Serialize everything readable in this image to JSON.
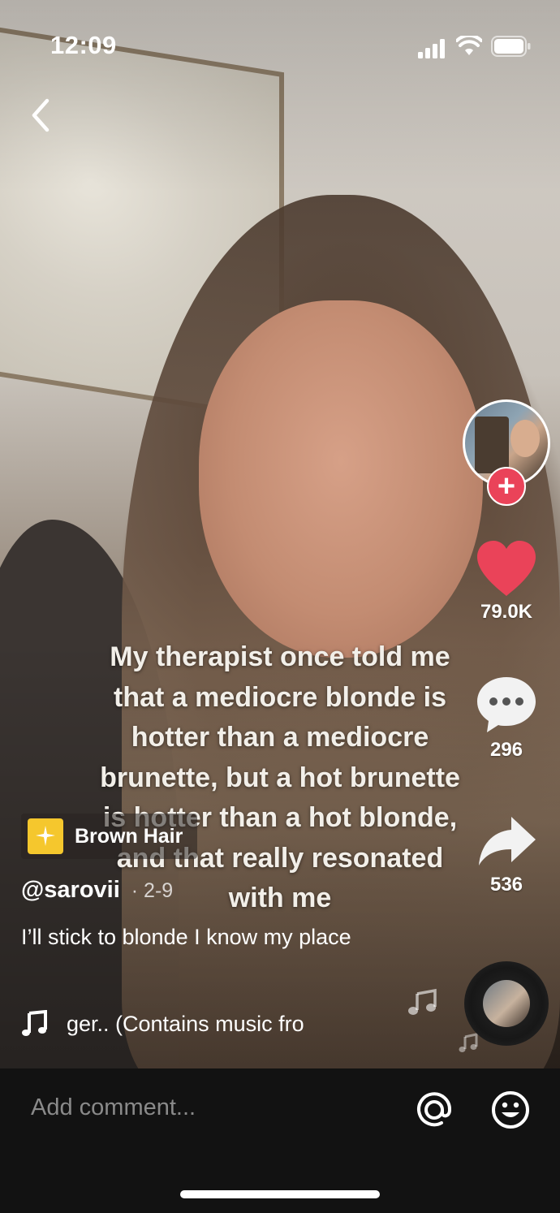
{
  "status_bar": {
    "time": "12:09"
  },
  "video": {
    "overlay_text": "My therapist once told me\nthat a mediocre blonde is\nhotter than a mediocre\nbrunette, but a hot brunette\nis hotter than a hot blonde,\nand that really resonated\nwith me"
  },
  "actions": {
    "likes": "79.0K",
    "comments": "296",
    "shares": "536",
    "like_color": "#ea4359"
  },
  "effect_tag": {
    "label": "Brown Hair"
  },
  "post": {
    "username": "@sarovii",
    "date": "· 2-9",
    "description": "I’ll stick to blonde I know my place",
    "music": "ger.. (Contains music fro"
  },
  "comment_bar": {
    "placeholder": "Add comment..."
  }
}
